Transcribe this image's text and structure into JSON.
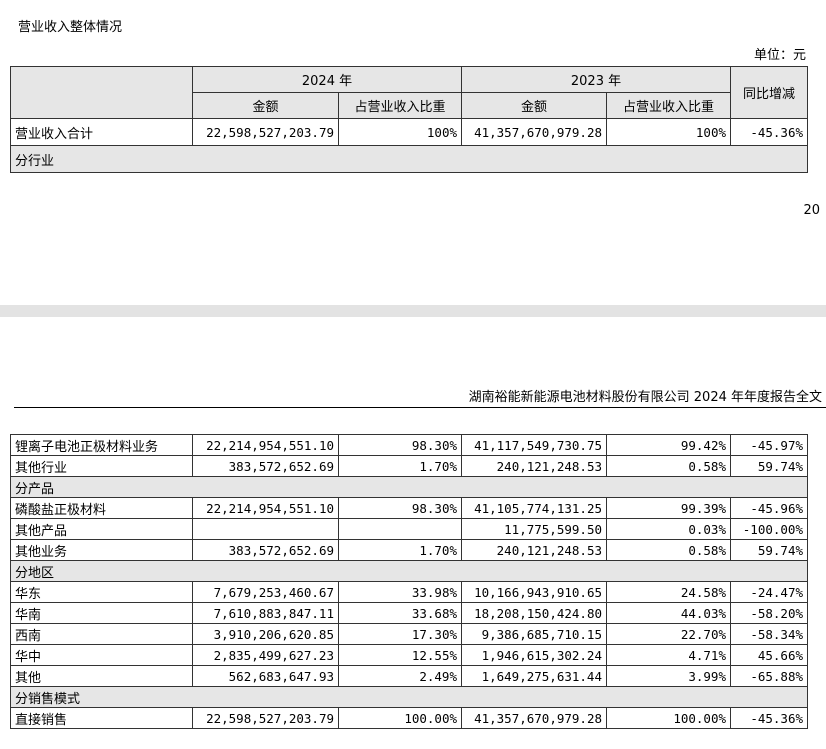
{
  "section_title": "营业收入整体情况",
  "unit_label": "单位：元",
  "page_number": "20",
  "report_header": "湖南裕能新能源电池材料股份有限公司 2024 年年度报告全文",
  "table_header": {
    "year_2024": "2024 年",
    "year_2023": "2023 年",
    "yoy": "同比增减",
    "amount": "金额",
    "share": "占营业收入比重"
  },
  "top_rows": {
    "total": {
      "label": "营业收入合计",
      "amount_2024": "22,598,527,203.79",
      "share_2024": "100%",
      "amount_2023": "41,357,670,979.28",
      "share_2023": "100%",
      "yoy": "-45.36%"
    },
    "group_industry": "分行业"
  },
  "bottom_rows": [
    {
      "type": "row",
      "label": "锂离子电池正极材料业务",
      "amount_2024": "22,214,954,551.10",
      "share_2024": "98.30%",
      "amount_2023": "41,117,549,730.75",
      "share_2023": "99.42%",
      "yoy": "-45.97%"
    },
    {
      "type": "row",
      "label": "其他行业",
      "amount_2024": "383,572,652.69",
      "share_2024": "1.70%",
      "amount_2023": "240,121,248.53",
      "share_2023": "0.58%",
      "yoy": "59.74%"
    },
    {
      "type": "group",
      "label": "分产品"
    },
    {
      "type": "row",
      "label": "磷酸盐正极材料",
      "amount_2024": "22,214,954,551.10",
      "share_2024": "98.30%",
      "amount_2023": "41,105,774,131.25",
      "share_2023": "99.39%",
      "yoy": "-45.96%"
    },
    {
      "type": "row",
      "label": "其他产品",
      "amount_2024": "",
      "share_2024": "",
      "amount_2023": "11,775,599.50",
      "share_2023": "0.03%",
      "yoy": "-100.00%"
    },
    {
      "type": "row",
      "label": "其他业务",
      "amount_2024": "383,572,652.69",
      "share_2024": "1.70%",
      "amount_2023": "240,121,248.53",
      "share_2023": "0.58%",
      "yoy": "59.74%"
    },
    {
      "type": "group",
      "label": "分地区"
    },
    {
      "type": "row",
      "label": "华东",
      "amount_2024": "7,679,253,460.67",
      "share_2024": "33.98%",
      "amount_2023": "10,166,943,910.65",
      "share_2023": "24.58%",
      "yoy": "-24.47%"
    },
    {
      "type": "row",
      "label": "华南",
      "amount_2024": "7,610,883,847.11",
      "share_2024": "33.68%",
      "amount_2023": "18,208,150,424.80",
      "share_2023": "44.03%",
      "yoy": "-58.20%"
    },
    {
      "type": "row",
      "label": "西南",
      "amount_2024": "3,910,206,620.85",
      "share_2024": "17.30%",
      "amount_2023": "9,386,685,710.15",
      "share_2023": "22.70%",
      "yoy": "-58.34%"
    },
    {
      "type": "row",
      "label": "华中",
      "amount_2024": "2,835,499,627.23",
      "share_2024": "12.55%",
      "amount_2023": "1,946,615,302.24",
      "share_2023": "4.71%",
      "yoy": "45.66%"
    },
    {
      "type": "row",
      "label": "其他",
      "amount_2024": "562,683,647.93",
      "share_2024": "2.49%",
      "amount_2023": "1,649,275,631.44",
      "share_2023": "3.99%",
      "yoy": "-65.88%"
    },
    {
      "type": "group",
      "label": "分销售模式"
    },
    {
      "type": "row",
      "label": "直接销售",
      "amount_2024": "22,598,527,203.79",
      "share_2024": "100.00%",
      "amount_2023": "41,357,670,979.28",
      "share_2023": "100.00%",
      "yoy": "-45.36%"
    }
  ]
}
